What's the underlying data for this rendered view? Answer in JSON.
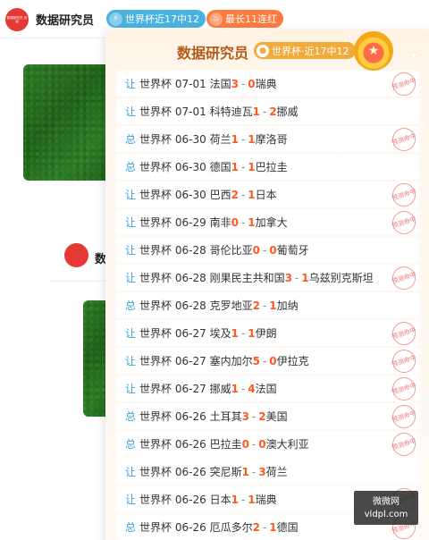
{
  "header": {
    "avatar_text": "数据研究员 世界",
    "name": "数据研究员",
    "badge_streak_icon": "lightning-icon",
    "badge_streak": "世界杯近17中12",
    "badge_longest_icon": "flame-icon",
    "badge_longest": "最长11连红"
  },
  "feed": {
    "second_name": "数"
  },
  "popup": {
    "title": "数据研究员",
    "tag": "世界杯·近17中12",
    "medal_icon": "star-medal-icon",
    "stamp_text": "预测命中",
    "rows": [
      {
        "mark": "让",
        "league": "世界杯",
        "date": "07-01",
        "home": "法国",
        "hs": "3",
        "as": "0",
        "away": "瑞典",
        "hit": true
      },
      {
        "mark": "让",
        "league": "世界杯",
        "date": "07-01",
        "home": "科特迪瓦",
        "hs": "1",
        "as": "2",
        "away": "挪威",
        "hit": false
      },
      {
        "mark": "总",
        "league": "世界杯",
        "date": "06-30",
        "home": "荷兰",
        "hs": "1",
        "as": "1",
        "away": "摩洛哥",
        "hit": true
      },
      {
        "mark": "总",
        "league": "世界杯",
        "date": "06-30",
        "home": "德国",
        "hs": "1",
        "as": "1",
        "away": "巴拉圭",
        "hit": false
      },
      {
        "mark": "让",
        "league": "世界杯",
        "date": "06-30",
        "home": "巴西",
        "hs": "2",
        "as": "1",
        "away": "日本",
        "hit": true
      },
      {
        "mark": "让",
        "league": "世界杯",
        "date": "06-29",
        "home": "南非",
        "hs": "0",
        "as": "1",
        "away": "加拿大",
        "hit": true
      },
      {
        "mark": "让",
        "league": "世界杯",
        "date": "06-28",
        "home": "哥伦比亚",
        "hs": "0",
        "as": "0",
        "away": "葡萄牙",
        "hit": false
      },
      {
        "mark": "让",
        "league": "世界杯",
        "date": "06-28",
        "home": "刚果民主共和国",
        "hs": "3",
        "as": "1",
        "away": "乌兹别克斯坦",
        "hit": true
      },
      {
        "mark": "总",
        "league": "世界杯",
        "date": "06-28",
        "home": "克罗地亚",
        "hs": "2",
        "as": "1",
        "away": "加纳",
        "hit": false
      },
      {
        "mark": "让",
        "league": "世界杯",
        "date": "06-27",
        "home": "埃及",
        "hs": "1",
        "as": "1",
        "away": "伊朗",
        "hit": true
      },
      {
        "mark": "让",
        "league": "世界杯",
        "date": "06-27",
        "home": "塞内加尔",
        "hs": "5",
        "as": "0",
        "away": "伊拉克",
        "hit": true
      },
      {
        "mark": "让",
        "league": "世界杯",
        "date": "06-27",
        "home": "挪威",
        "hs": "1",
        "as": "4",
        "away": "法国",
        "hit": true
      },
      {
        "mark": "总",
        "league": "世界杯",
        "date": "06-26",
        "home": "土耳其",
        "hs": "3",
        "as": "2",
        "away": "美国",
        "hit": true
      },
      {
        "mark": "总",
        "league": "世界杯",
        "date": "06-26",
        "home": "巴拉圭",
        "hs": "0",
        "as": "0",
        "away": "澳大利亚",
        "hit": true
      },
      {
        "mark": "让",
        "league": "世界杯",
        "date": "06-26",
        "home": "突尼斯",
        "hs": "1",
        "as": "3",
        "away": "荷兰",
        "hit": false
      },
      {
        "mark": "让",
        "league": "世界杯",
        "date": "06-26",
        "home": "日本",
        "hs": "1",
        "as": "1",
        "away": "瑞典",
        "hit": true
      },
      {
        "mark": "总",
        "league": "世界杯",
        "date": "06-26",
        "home": "厄瓜多尔",
        "hs": "2",
        "as": "1",
        "away": "德国",
        "hit": true
      }
    ]
  },
  "watermark": {
    "line1": "微微网",
    "line2": "vldpl.com"
  }
}
